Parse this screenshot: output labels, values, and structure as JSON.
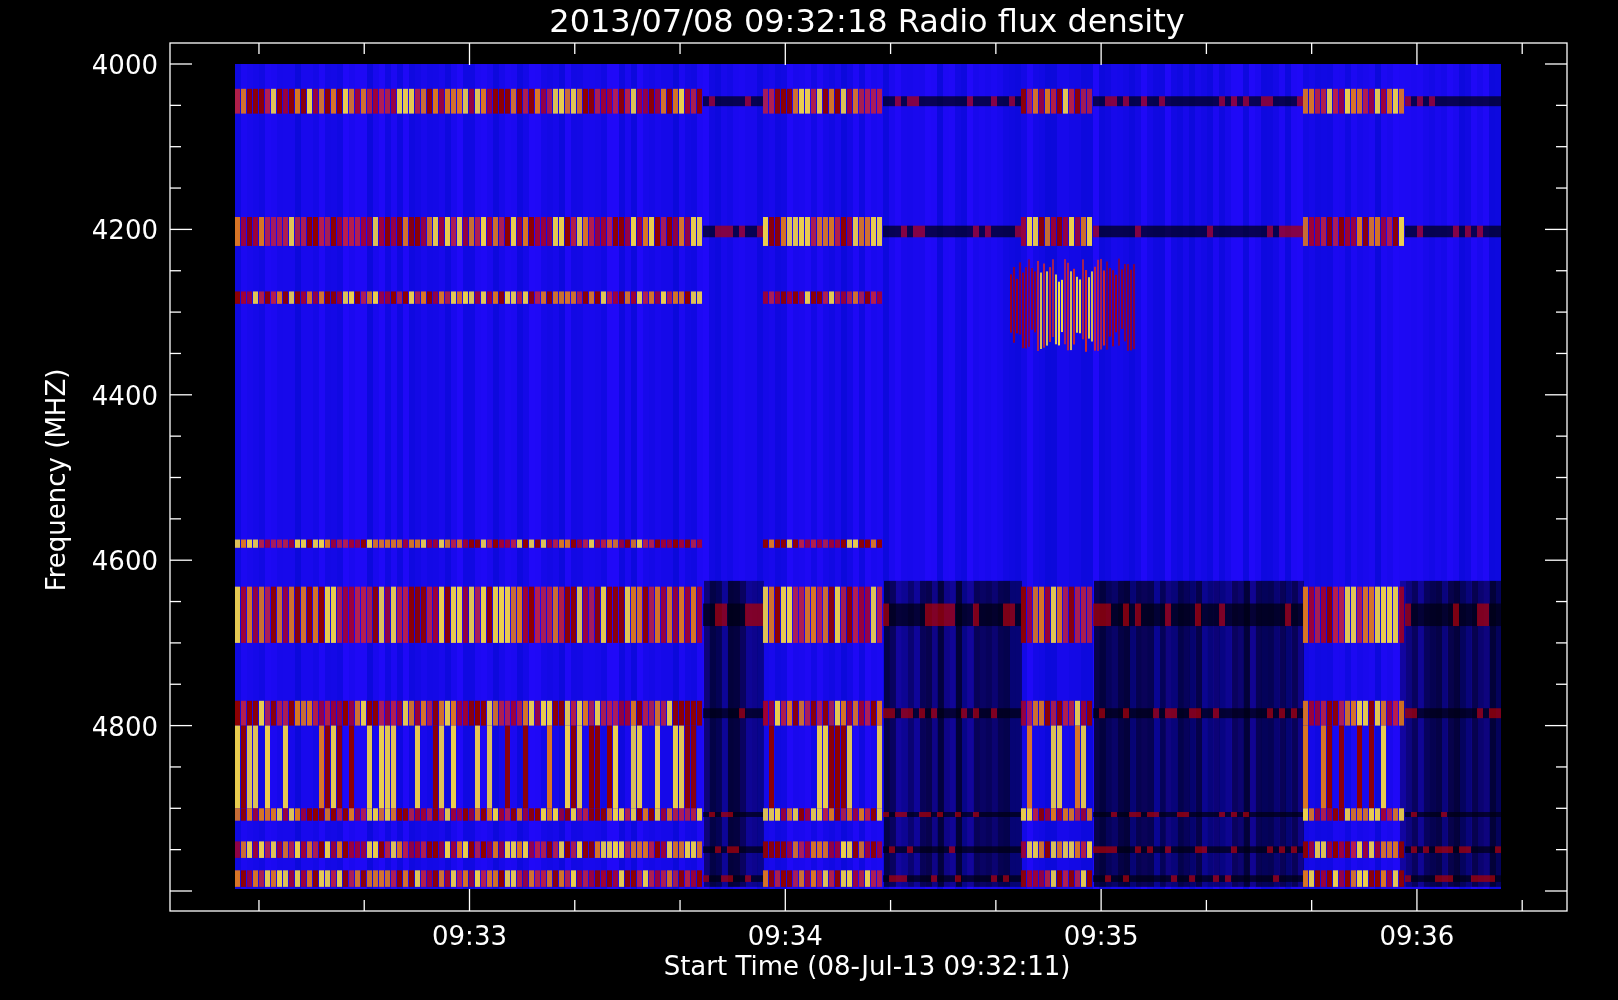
{
  "title": "2013/07/08 09:32:18 Radio flux density",
  "y_axis": {
    "label": "Frequency (MHZ)",
    "ticks": [
      "4000",
      "4200",
      "4400",
      "4600",
      "4800"
    ]
  },
  "x_axis": {
    "label": "Start Time (08-Jul-13 09:32:11)",
    "ticks": [
      "09:33",
      "09:34",
      "09:35",
      "09:36"
    ]
  }
}
